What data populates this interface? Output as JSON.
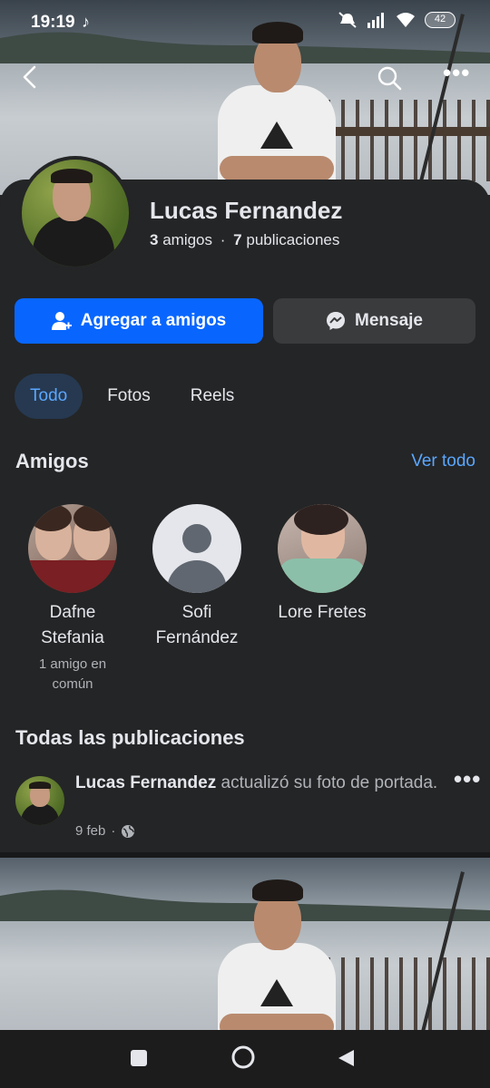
{
  "status_bar": {
    "time": "19:19",
    "battery": "42"
  },
  "profile": {
    "name": "Lucas Fernandez",
    "friends_count": "3",
    "friends_label": "amigos",
    "separator": "·",
    "posts_count": "7",
    "posts_label": "publicaciones"
  },
  "actions": {
    "add_friend": "Agregar a amigos",
    "message": "Mensaje"
  },
  "tabs": [
    {
      "label": "Todo",
      "active": true
    },
    {
      "label": "Fotos",
      "active": false
    },
    {
      "label": "Reels",
      "active": false
    }
  ],
  "friends_section": {
    "title": "Amigos",
    "see_all": "Ver todo",
    "friends": [
      {
        "name_line1": "Dafne",
        "name_line2": "Stefania",
        "mutual_line1": "1 amigo en",
        "mutual_line2": "común"
      },
      {
        "name_line1": "Sofi",
        "name_line2": "Fernández",
        "mutual_line1": "",
        "mutual_line2": ""
      },
      {
        "name_line1": "Lore Fretes",
        "name_line2": "",
        "mutual_line1": "",
        "mutual_line2": ""
      }
    ]
  },
  "posts_section": {
    "title": "Todas las publicaciones",
    "post": {
      "author": "Lucas Fernandez",
      "action": "actualizó su foto de portada.",
      "date": "9 feb",
      "dot": "·"
    }
  },
  "colors": {
    "accent": "#0866ff",
    "link": "#5aa7ff",
    "background": "#242526"
  }
}
